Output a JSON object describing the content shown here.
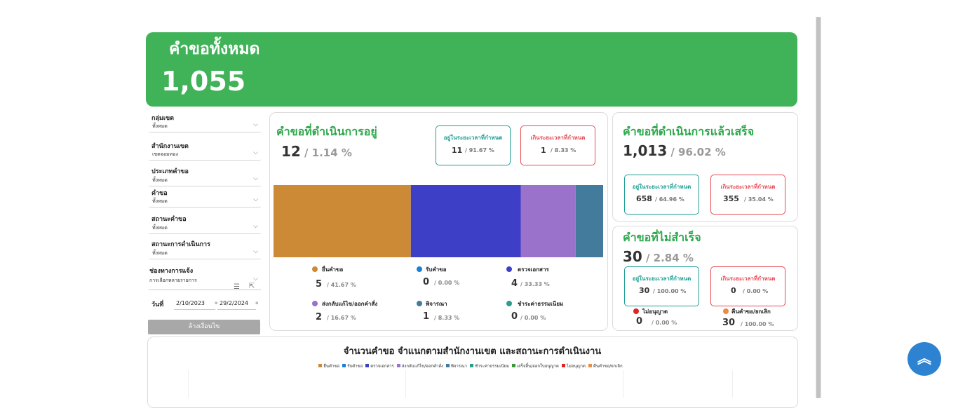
{
  "header": {
    "title": "คำขอทั้งหมด",
    "total": "1,055",
    "color": "#40b359"
  },
  "filters": [
    {
      "label": "กลุ่มเขต",
      "value": "ทั้งหมด"
    },
    {
      "label": "สำนักงานเขต",
      "value": "เขตจอมทอง"
    },
    {
      "label": "ประเภทคำขอ",
      "value": "ทั้งหมด"
    },
    {
      "label": "คำขอ",
      "value": "ทั้งหมด"
    },
    {
      "label": "สถานะคำขอ",
      "value": "ทั้งหมด"
    },
    {
      "label": "สถานะการดำเนินการ",
      "value": "ทั้งหมด"
    }
  ],
  "channel": {
    "label": "ช่องทางการแจ้ง",
    "value": "การเลือกหลายรายการ"
  },
  "date": {
    "label": "วันที่",
    "from": "2/10/2023",
    "to": "29/2/2024"
  },
  "clear_label": "ล้างเงื่อนไข",
  "in_progress": {
    "title": "คำขอที่ดำเนินการอยู่",
    "count": "12",
    "pct": "/ 1.14 %",
    "within": {
      "label": "อยู่ในระยะเวลาที่กำหนด",
      "count": "11",
      "pct": "/ 91.67 %"
    },
    "over": {
      "label": "เกินระยะเวลาที่กำหนด",
      "count": "1",
      "pct": "/ 8.33 %"
    },
    "chart_data": {
      "type": "bar",
      "orientation": "stacked-horizontal",
      "categories": [
        "ยื่นคำขอ",
        "รับคำขอ",
        "ตรวจเอกสาร",
        "ส่งกลับแก้ไข/ออกคำสั่ง",
        "พิจารณา",
        "ชำระค่าธรรมเนียม"
      ],
      "values": [
        5,
        0,
        4,
        2,
        1,
        0
      ],
      "colors": [
        "#cc8a36",
        "#1a7fd6",
        "#3d3fc6",
        "#9a72cc",
        "#427b9b",
        "#2a9d8f"
      ]
    },
    "legend": [
      {
        "label": "ยื่นคำขอ",
        "count": "5",
        "pct": "/ 41.67 %",
        "color": "#cc8a36"
      },
      {
        "label": "รับคำขอ",
        "count": "0",
        "pct": "/ 0.00 %",
        "color": "#1a7fd6"
      },
      {
        "label": "ตรวจเอกสาร",
        "count": "4",
        "pct": "/ 33.33 %",
        "color": "#3d3fc6"
      },
      {
        "label": "ส่งกลับแก้ไข/ออกคำสั่ง",
        "count": "2",
        "pct": "/ 16.67 %",
        "color": "#9a72cc"
      },
      {
        "label": "พิจารณา",
        "count": "1",
        "pct": "/ 8.33 %",
        "color": "#427b9b"
      },
      {
        "label": "ชำระค่าธรรมเนียม",
        "count": "0",
        "pct": "/ 0.00 %",
        "color": "#2a9d8f"
      }
    ]
  },
  "completed": {
    "title": "คำขอที่ดำเนินการแล้วเสร็จ",
    "count": "1,013",
    "pct": "/ 96.02 %",
    "within": {
      "label": "อยู่ในระยะเวลาที่กำหนด",
      "count": "658",
      "pct": "/ 64.96 %"
    },
    "over": {
      "label": "เกินระยะเวลาที่กำหนด",
      "count": "355",
      "pct": "/ 35.04 %"
    }
  },
  "failed": {
    "title": "คำขอที่ไม่สำเร็จ",
    "count": "30",
    "pct": "/ 2.84 %",
    "within": {
      "label": "อยู่ในระยะเวลาที่กำหนด",
      "count": "30",
      "pct": "/ 100.00 %"
    },
    "over": {
      "label": "เกินระยะเวลาที่กำหนด",
      "count": "0",
      "pct": "/ 0.00 %"
    },
    "not_approved": {
      "label": "ไม่อนุญาต",
      "count": "0",
      "pct": "/ 0.00 %",
      "color": "#e02424"
    },
    "cancelled": {
      "label": "คืนคำขอ/ยกเลิก",
      "count": "30",
      "pct": "/ 100.00 %",
      "color": "#f08a3c"
    }
  },
  "bottom_chart": {
    "title": "จำนวนคำขอ  จำแนกตามสำนักงานเขต และสถานะการดำเนินงาน",
    "legend": [
      {
        "label": "ยื่นคำขอ",
        "color": "#cc8a36"
      },
      {
        "label": "รับคำขอ",
        "color": "#1a7fd6"
      },
      {
        "label": "ตรวจเอกสาร",
        "color": "#3d3fc6"
      },
      {
        "label": "ส่งกลับแก้ไข/ออกคำสั่ง",
        "color": "#9a72cc"
      },
      {
        "label": "พิจารณา",
        "color": "#427b9b"
      },
      {
        "label": "ชำระค่าธรรมเนียม",
        "color": "#2a9d8f"
      },
      {
        "label": "เสร็จสิ้น/ออกใบอนุญาต",
        "color": "#3a9a3a"
      },
      {
        "label": "ไม่อนุญาต",
        "color": "#e02424"
      },
      {
        "label": "คืนคำขอ/ยกเลิก",
        "color": "#f08a3c"
      }
    ]
  }
}
